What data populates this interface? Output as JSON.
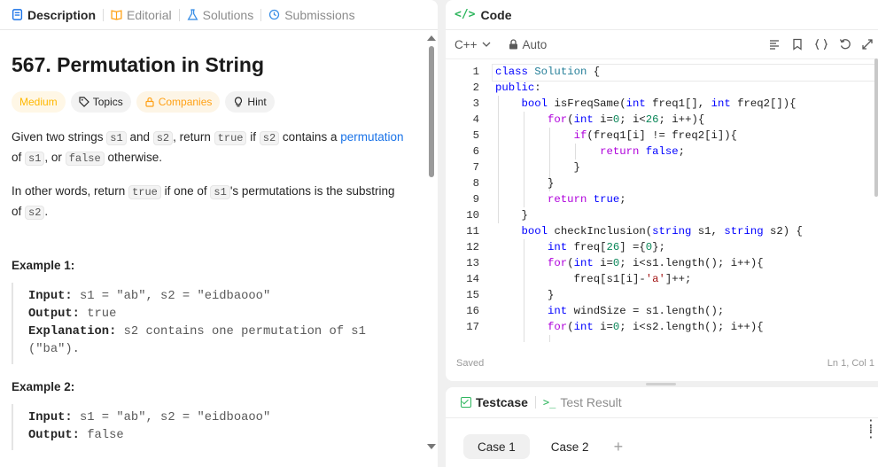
{
  "left_tabs": [
    {
      "label": "Description",
      "icon": "description-icon"
    },
    {
      "label": "Editorial",
      "icon": "book-icon"
    },
    {
      "label": "Solutions",
      "icon": "flask-icon"
    },
    {
      "label": "Submissions",
      "icon": "history-icon"
    }
  ],
  "problem": {
    "title": "567. Permutation in String",
    "tags": {
      "difficulty": "Medium",
      "topics": "Topics",
      "companies": "Companies",
      "hint": "Hint"
    },
    "desc1": {
      "a": "Given two strings ",
      "s1": "s1",
      "b": " and ",
      "s2": "s2",
      "c": ", return ",
      "true": "true",
      "d": " if ",
      "s2b": "s2",
      "e": " contains a ",
      "link": "permutation",
      "f": "of ",
      "s1b": "s1",
      "g": ", or ",
      "false": "false",
      "h": " otherwise."
    },
    "desc2": {
      "a": "In other words, return ",
      "true": "true",
      "b": " if one of ",
      "s1": "s1",
      "c": "'s permutations is the substring",
      "d": "of ",
      "s2": "s2",
      "e": "."
    },
    "example1": {
      "title": "Example 1:",
      "input_label": "Input:",
      "input": " s1 = \"ab\", s2 = \"eidbaooo\"",
      "output_label": "Output:",
      "output": " true",
      "expl_label": "Explanation:",
      "expl": " s2 contains one permutation of s1",
      "expl2": "(\"ba\")."
    },
    "example2": {
      "title": "Example 2:",
      "input_label": "Input:",
      "input": " s1 = \"ab\", s2 = \"eidboaoo\"",
      "output_label": "Output:",
      "output": " false"
    }
  },
  "code_panel": {
    "title": "Code",
    "language": "C++",
    "mode": "Auto",
    "status": "Saved",
    "cursor": "Ln 1, Col 1",
    "lines": [
      {
        "n": "1"
      },
      {
        "n": "2"
      },
      {
        "n": "3"
      },
      {
        "n": "4"
      },
      {
        "n": "5"
      },
      {
        "n": "6"
      },
      {
        "n": "7"
      },
      {
        "n": "8"
      },
      {
        "n": "9"
      },
      {
        "n": "10"
      },
      {
        "n": "11"
      },
      {
        "n": "12"
      },
      {
        "n": "13"
      },
      {
        "n": "14"
      },
      {
        "n": "15"
      },
      {
        "n": "16"
      },
      {
        "n": "17"
      }
    ]
  },
  "test_panel": {
    "testcase_label": "Testcase",
    "result_label": "Test Result",
    "cases": [
      "Case 1",
      "Case 2"
    ],
    "add": "+"
  },
  "colors": {
    "accent_green": "#2db55d",
    "medium": "#ffb800",
    "link": "#1a73e8"
  }
}
